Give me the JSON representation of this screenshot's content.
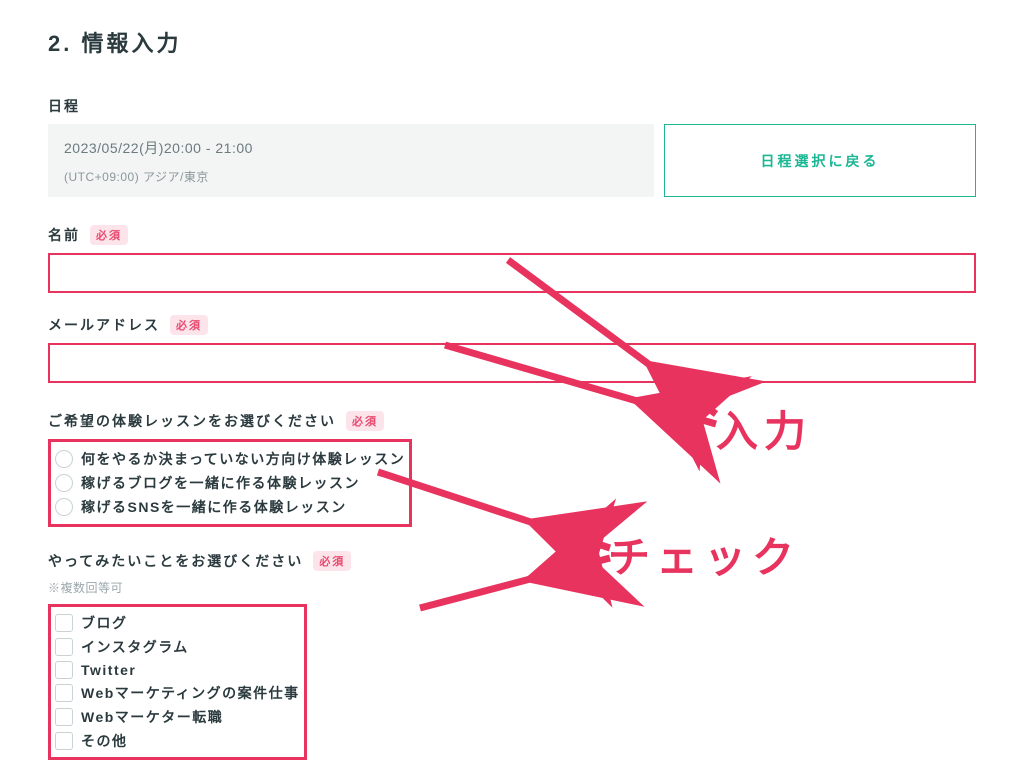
{
  "section_title": "2. 情報入力",
  "schedule": {
    "label": "日程",
    "datetime": "2023/05/22(月)20:00 - 21:00",
    "tz": "(UTC+09:00) アジア/東京",
    "back_button": "日程選択に戻る"
  },
  "name_field": {
    "label": "名前",
    "required": "必須",
    "value": ""
  },
  "email_field": {
    "label": "メールアドレス",
    "required": "必須",
    "value": ""
  },
  "lesson_field": {
    "label": "ご希望の体験レッスンをお選びください",
    "required": "必須",
    "options": [
      "何をやるか決まっていない方向け体験レッスン",
      "稼げるブログを一緒に作る体験レッスン",
      "稼げるSNSを一緒に作る体験レッスン"
    ]
  },
  "todo_field": {
    "label": "やってみたいことをお選びください",
    "required": "必須",
    "note": "※複数回等可",
    "options": [
      "ブログ",
      "インスタグラム",
      "Twitter",
      "Webマーケティングの案件仕事",
      "Webマーケター転職",
      "その他"
    ]
  },
  "annotations": {
    "input_label": "入力",
    "check_label": "チェック"
  }
}
